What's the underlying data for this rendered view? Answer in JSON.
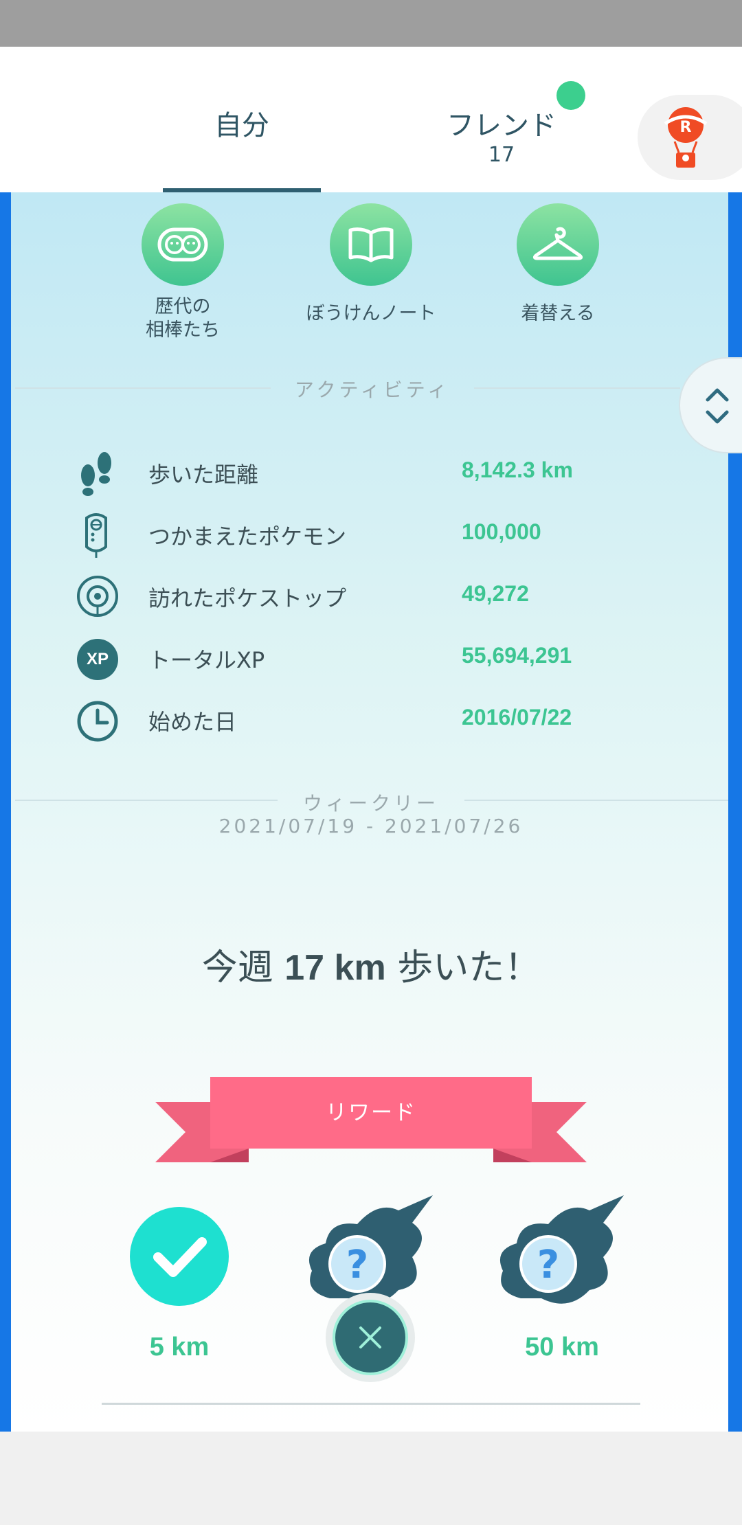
{
  "header": {
    "tab_self": "自分",
    "tab_friend": "フレンド",
    "friend_count": "17"
  },
  "menu": [
    {
      "label_line1": "歴代の",
      "label_line2": "相棒たち",
      "icon": "buddy-faces-icon"
    },
    {
      "label": "ぼうけんノート",
      "icon": "book-icon"
    },
    {
      "label": "着替える",
      "icon": "hanger-icon"
    }
  ],
  "activity": {
    "title": "アクティビティ",
    "stats": [
      {
        "label": "歩いた距離",
        "value": "8,142.3 km",
        "icon": "footprints-icon"
      },
      {
        "label": "つかまえたポケモン",
        "value": "100,000",
        "icon": "pokedex-icon"
      },
      {
        "label": "訪れたポケストップ",
        "value": "49,272",
        "icon": "pokestop-icon"
      },
      {
        "label": "トータルXP",
        "value": "55,694,291",
        "icon": "xp-icon"
      },
      {
        "label": "始めた日",
        "value": "2016/07/22",
        "icon": "clock-icon"
      }
    ],
    "xp_badge": "XP"
  },
  "weekly": {
    "title": "ウィークリー",
    "date_range": "2021/07/19 - 2021/07/26",
    "headline_prefix": "今週 ",
    "headline_value": "17 km",
    "headline_suffix": " 歩いた！",
    "reward_title": "リワード",
    "rewards": [
      {
        "label": "5 km",
        "state": "completed"
      },
      {
        "label": "",
        "state": "locked"
      },
      {
        "label": "50 km",
        "state": "locked"
      }
    ]
  },
  "colors": {
    "accent_green": "#3cc592",
    "tab_underline": "#2f5f71",
    "ribbon_pink": "#ff6b88",
    "side_blue": "#1677e6",
    "check_teal": "#1ee0d0"
  }
}
